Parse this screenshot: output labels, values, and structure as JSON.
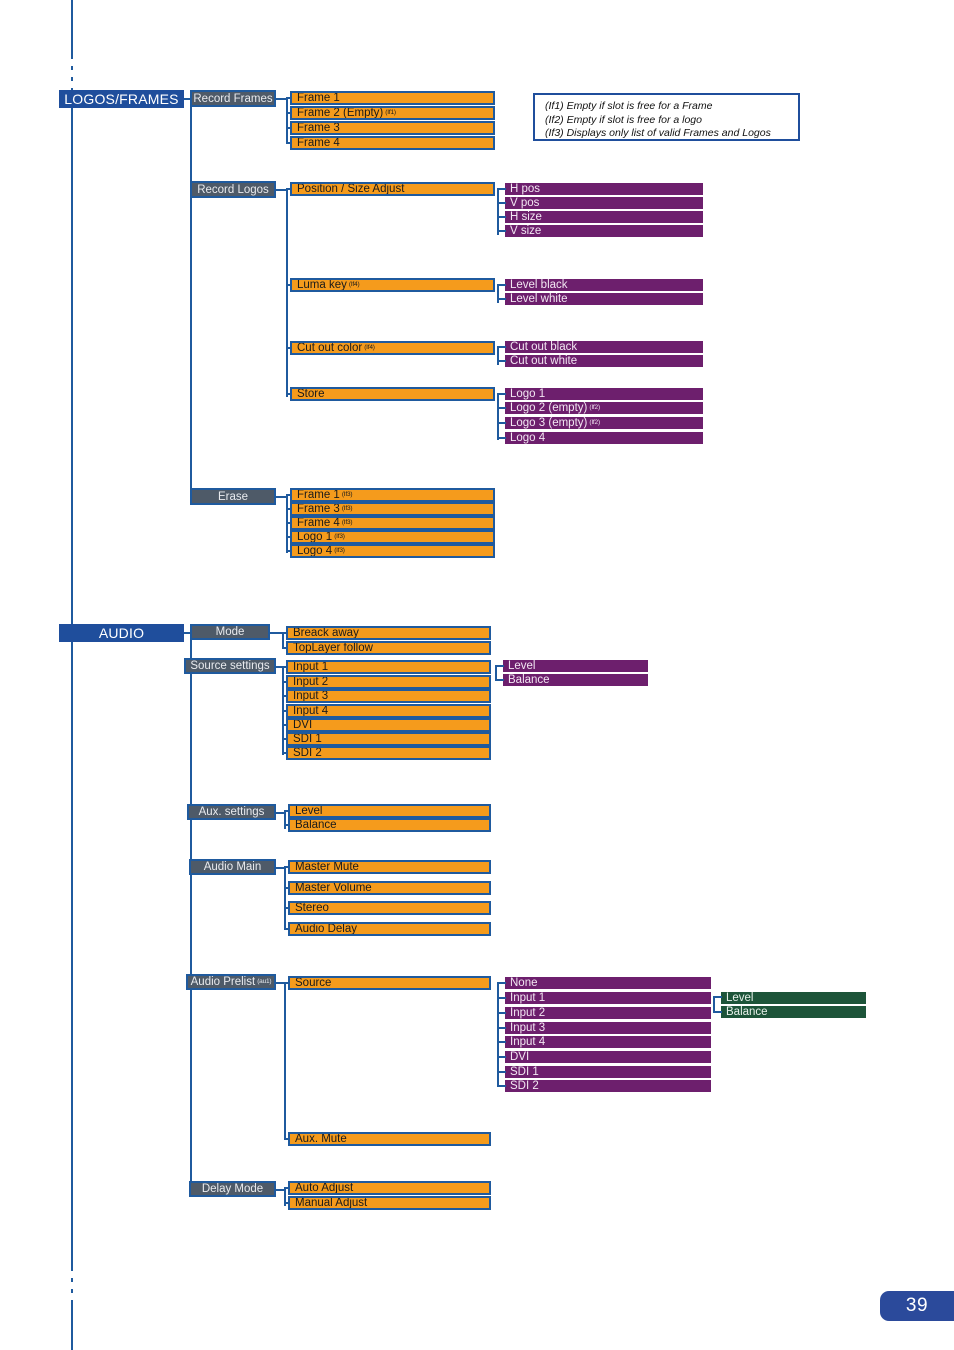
{
  "page": {
    "number": "39"
  },
  "legend": {
    "lines": [
      "(If1) Empty if slot is free for a Frame",
      "(If2) Empty if slot is free for a logo",
      "(If3) Displays only list of valid Frames and Logos"
    ]
  },
  "sections": {
    "logos_frames": {
      "title": "LOGOS/FRAMES",
      "groups": {
        "record_frames": {
          "label": "Record Frames",
          "items": [
            {
              "label": "Frame 1",
              "sup": ""
            },
            {
              "label": "Frame 2 (Empty)",
              "sup": "(If1)"
            },
            {
              "label": "Frame 3",
              "sup": ""
            },
            {
              "label": "Frame 4",
              "sup": ""
            }
          ]
        },
        "record_logos": {
          "label": "Record Logos",
          "items": [
            {
              "label": "Position / Size Adjust",
              "sup": ""
            },
            {
              "label": "Luma key",
              "sup": "(If4)"
            },
            {
              "label": "Cut out color",
              "sup": "(If4)"
            },
            {
              "label": "Store",
              "sup": ""
            }
          ],
          "position_size_children": [
            "H pos",
            "V pos",
            "H size",
            "V size"
          ],
          "luma_key_children": [
            "Level black",
            "Level white"
          ],
          "cut_out_children": [
            "Cut out black",
            "Cut out white"
          ],
          "store_children": [
            {
              "label": "Logo 1",
              "sup": ""
            },
            {
              "label": "Logo 2 (empty)",
              "sup": "(If2)"
            },
            {
              "label": "Logo 3 (empty)",
              "sup": "(If2)"
            },
            {
              "label": "Logo 4",
              "sup": ""
            }
          ]
        },
        "erase": {
          "label": "Erase",
          "items": [
            {
              "label": "Frame 1",
              "sup": "(If3)"
            },
            {
              "label": "Frame 3",
              "sup": "(If3)"
            },
            {
              "label": "Frame 4",
              "sup": "(If3)"
            },
            {
              "label": "Logo 1",
              "sup": "(If3)"
            },
            {
              "label": "Logo 4",
              "sup": "(If3)"
            }
          ]
        }
      }
    },
    "audio": {
      "title": "AUDIO",
      "groups": {
        "mode": {
          "label": "Mode",
          "items": [
            "Breack away",
            "TopLayer follow"
          ]
        },
        "source_settings": {
          "label": "Source settings",
          "items": [
            "Input 1",
            "Input 2",
            "Input 3",
            "Input 4",
            "DVI",
            "SDI 1",
            "SDI 2"
          ],
          "input1_children": [
            "Level",
            "Balance"
          ]
        },
        "aux_settings": {
          "label": "Aux. settings",
          "items": [
            "Level",
            "Balance"
          ]
        },
        "audio_main": {
          "label": "Audio Main",
          "items": [
            "Master Mute",
            "Master Volume",
            "Stereo",
            "Audio Delay"
          ]
        },
        "audio_prelist": {
          "label": "Audio Prelist",
          "sup": "(au1)",
          "items": [
            "Source",
            "Aux. Mute"
          ],
          "source_children": [
            "None",
            "Input 1",
            "Input 2",
            "Input 3",
            "Input 4",
            "DVI",
            "SDI 1",
            "SDI 2"
          ],
          "input1_children": [
            "Level",
            "Balance"
          ]
        },
        "delay_mode": {
          "label": "Delay Mode",
          "items": [
            "Auto Adjust",
            "Manual Adjust"
          ]
        }
      }
    }
  },
  "colors": {
    "root": "#1f4e9c",
    "group": "#4e5a68",
    "item": "#f59b1c",
    "sub": "#6d1f6d",
    "subsub": "#1d5439",
    "connector": "#1f5a9e"
  }
}
